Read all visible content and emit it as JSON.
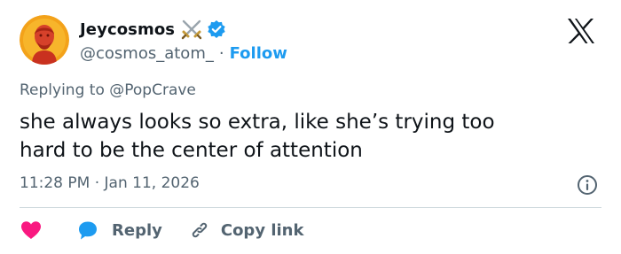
{
  "author": {
    "display_name": "Jeycosmos",
    "handle": "@cosmos_atom_",
    "separator": "·",
    "follow_label": "Follow",
    "avatar_icon": "philosopher-bust-avatar",
    "badge_emoji_icon": "crossed-swords-icon",
    "verified_icon": "verified-badge-icon"
  },
  "replying_to": "Replying to @PopCrave",
  "tweet": {
    "text": "she always looks so extra, like she’s trying too\nhard to be the center of attention",
    "timestamp": "11:28 PM · Jan 11, 2026"
  },
  "actions": {
    "reply_label": "Reply",
    "copy_link_label": "Copy link"
  },
  "colors": {
    "accent": "#1d9bf0",
    "heart": "#f91880",
    "secondary_text": "#536471",
    "primary_text": "#0f1419",
    "divider": "#cfd9de"
  }
}
